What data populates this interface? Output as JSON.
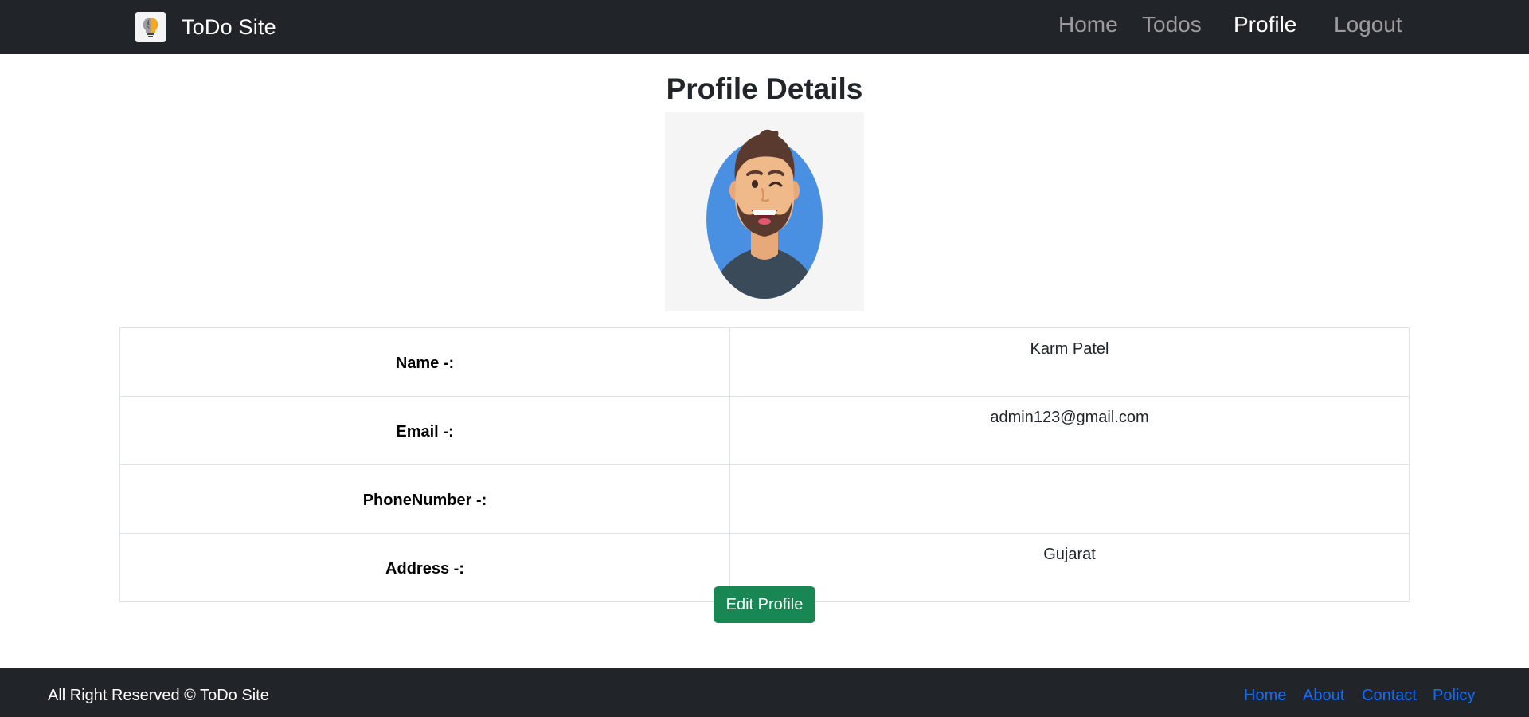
{
  "navbar": {
    "brand_name": "ToDo Site",
    "logo_icon": "lightbulb-brain-logo-icon",
    "links": [
      "Home",
      "Todos",
      "Profile",
      "Logout"
    ],
    "active_link": "Profile"
  },
  "main": {
    "title": "Profile Details",
    "avatar_icon": "bearded-man-avatar-icon",
    "rows": [
      {
        "label": "Name -:",
        "value": "Karm Patel"
      },
      {
        "label": "Email -:",
        "value": "admin123@gmail.com"
      },
      {
        "label": "PhoneNumber -:",
        "value": ""
      },
      {
        "label": "Address -:",
        "value": "Gujarat"
      }
    ],
    "edit_button_label": "Edit Profile"
  },
  "footer": {
    "copyright": "All Right Reserved © ToDo Site",
    "links": [
      "Home",
      "About",
      "Contact",
      "Policy"
    ]
  },
  "colors": {
    "navbar_bg": "#212529",
    "button_success": "#198754",
    "footer_link": "#0d6efd",
    "avatar_backdrop": "#4a90e2"
  }
}
